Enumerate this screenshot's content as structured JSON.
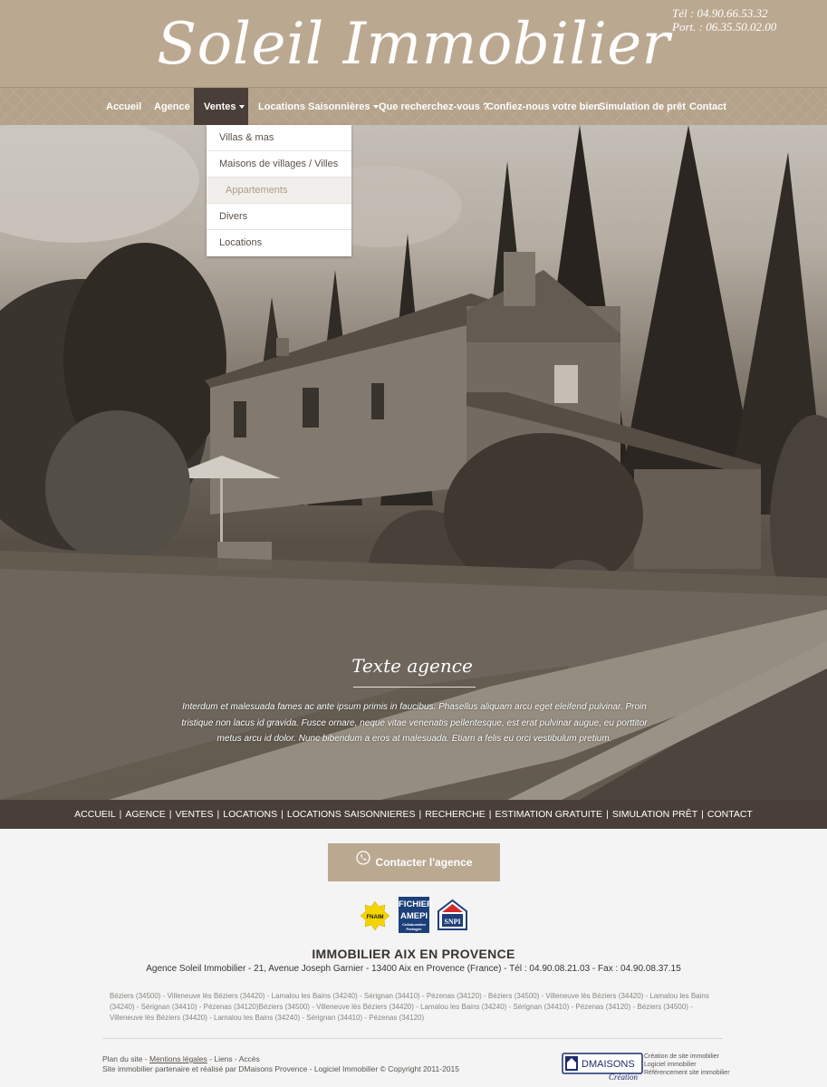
{
  "header": {
    "logo": "Soleil Immobilier",
    "phone_tel": "Tél : 04.90.66.53.32",
    "phone_port": "Port. : 06.35.50.02.00"
  },
  "nav": {
    "items": [
      {
        "label": "Accueil"
      },
      {
        "label": "Agence"
      },
      {
        "label": "Ventes",
        "active": true,
        "dropdown": true
      },
      {
        "label": "Locations Saisonnières",
        "dropdown": true
      },
      {
        "label": "Que recherchez-vous ?"
      },
      {
        "label": "Confiez-nous votre bien"
      },
      {
        "label": "Simulation de prêt"
      },
      {
        "label": "Contact"
      }
    ]
  },
  "dropdown": {
    "items": [
      {
        "label": "Villas & mas"
      },
      {
        "label": "Maisons de villages / Villes"
      },
      {
        "label": "Appartements",
        "selected": true
      },
      {
        "label": "Divers"
      },
      {
        "label": "Locations"
      }
    ]
  },
  "hero": {
    "title": "Texte agence",
    "text": "Interdum et malesuada fames ac ante ipsum primis in faucibus. Phasellus aliquam arcu eget eleifend pulvinar. Proin tristique non lacus id gravida. Fusce ornare, neque vitae venenatis pellentesque, est erat pulvinar augue, eu porttitor metus arcu id dolor. Nunc bibendum a eros at malesuada. Etiam a felis eu orci vestibulum pretium."
  },
  "footer_nav": {
    "items": [
      "ACCUEIL",
      "AGENCE",
      "VENTES",
      "LOCATIONS",
      "LOCATIONS SAISONNIERES",
      "RECHERCHE",
      "ESTIMATION GRATUITE",
      "SIMULATION PRÊT",
      "CONTACT"
    ],
    "separator": "|"
  },
  "contact": {
    "button_label": "Contacter l'agence"
  },
  "logos": {
    "fnaim": "FNAIM",
    "amepi_top": "FICHIER",
    "amepi_bottom": "AMEPI",
    "amepi_small": "Collaboration Partagée",
    "snpi": "SNPI"
  },
  "agency": {
    "title": "IMMOBILIER AIX EN PROVENCE",
    "address": "Agence Soleil Immobilier - 21, Avenue Joseph Garnier - 13400 Aix en Provence (France) - Tél : 04.90.08.21.03 - Fax : 04.90.08.37.15"
  },
  "seo_text": "Béziers (34500) - Villeneuve lès Béziers (34420) - Lamalou les Bains (34240) - Sérignan (34410) - Pézenas (34120) - Béziers (34500) - Villeneuve lès Béziers (34420) - Lamalou les Bains (34240) - Sérignan (34410) - Pézenas (34120)Béziers (34500) - Villeneuve lès Béziers (34420) - Lamalou les Bains (34240) - Sérignan (34410) - Pézenas (34120) - Béziers (34500) - Villeneuve lès Béziers (34420) - Lamalou les Bains (34240) - Sérignan (34410) - Pézenas (34120)",
  "bottom": {
    "plan_du_site": "Plan du site",
    "mentions": "Mentions légales",
    "liens": "Liens",
    "acces": "Accès",
    "dash": " - ",
    "credit": "Site immobilier partenaire et réalisé par DMaisons Provence - Logiciel Immobilier © Copyright 2011-2015",
    "dm_logo_main": "DMAISONS",
    "dm_logo_sub": "Création",
    "dm_lines": [
      "Création de site immobilier",
      "Logiciel immobilier",
      "Référencement site immobilier"
    ]
  },
  "colors": {
    "brand": "#bba891",
    "dark": "#4a3f38",
    "dropdown_selected_text": "#b09a82"
  }
}
